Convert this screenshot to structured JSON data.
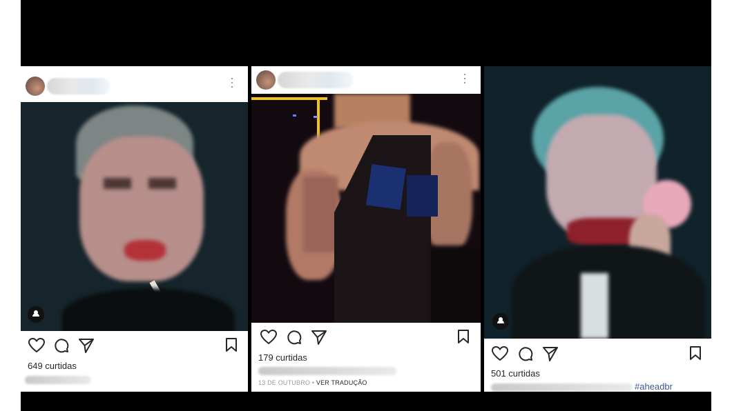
{
  "posts": [
    {
      "likes": "649 curtidas",
      "caption_visible": "",
      "icons": [
        "heart-icon",
        "comment-icon",
        "share-icon",
        "bookmark-icon"
      ]
    },
    {
      "likes": "179 curtidas",
      "caption_visible": "",
      "date": "13 DE OUTUBRO",
      "separator": " • ",
      "translate": "VER TRADUÇÃO",
      "icons": [
        "heart-icon",
        "comment-icon",
        "share-icon",
        "bookmark-icon"
      ]
    },
    {
      "likes": "501 curtidas",
      "caption_visible": "#aheadbr",
      "icons": [
        "heart-icon",
        "comment-icon",
        "share-icon",
        "bookmark-icon"
      ]
    }
  ],
  "colors": {
    "frame": "#000000",
    "text": "#262626",
    "meta": "#999999",
    "hashtag": "#385898"
  }
}
